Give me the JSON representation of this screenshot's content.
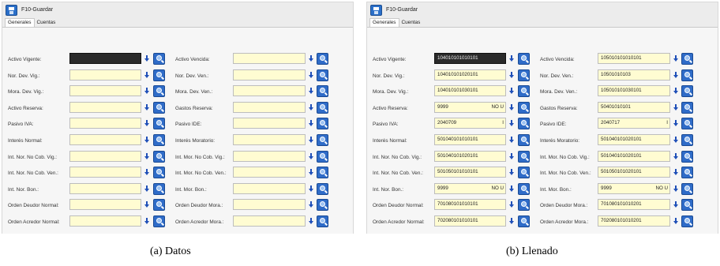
{
  "window_title": "F10-Guardar",
  "tabs": [
    "Generales",
    "Cuentas"
  ],
  "captions": [
    "(a)  Datos",
    "(b)  Llenado"
  ],
  "panels": [
    {
      "rows": [
        {
          "left": {
            "label": "Activo Vigente:",
            "value": "",
            "suffix": ""
          },
          "right": {
            "label": "Activo Vencida:",
            "value": "",
            "suffix": ""
          }
        },
        {
          "left": {
            "label": "Nor. Dev. Vig.:",
            "value": "",
            "suffix": ""
          },
          "right": {
            "label": "Nor. Dev. Ven.:",
            "value": "",
            "suffix": ""
          }
        },
        {
          "left": {
            "label": "Mora. Dev. Vig.:",
            "value": "",
            "suffix": ""
          },
          "right": {
            "label": "Mora. Dev. Ven.:",
            "value": "",
            "suffix": ""
          }
        },
        {
          "left": {
            "label": "Activo Reserva:",
            "value": "",
            "suffix": ""
          },
          "right": {
            "label": "Gastos Reserva:",
            "value": "",
            "suffix": ""
          }
        },
        {
          "left": {
            "label": "Pasivo IVA:",
            "value": "",
            "suffix": ""
          },
          "right": {
            "label": "Pasivo IDE:",
            "value": "",
            "suffix": ""
          }
        },
        {
          "left": {
            "label": "Interés Normal:",
            "value": "",
            "suffix": ""
          },
          "right": {
            "label": "Interés Moratorio:",
            "value": "",
            "suffix": ""
          }
        },
        {
          "left": {
            "label": "Int. Nor. No Cob. Vig.:",
            "value": "",
            "suffix": ""
          },
          "right": {
            "label": "Int. Mor. No Cob. Vig.:",
            "value": "",
            "suffix": ""
          }
        },
        {
          "left": {
            "label": "Int. Nor. No Cob. Ven.:",
            "value": "",
            "suffix": ""
          },
          "right": {
            "label": "Int. Mor. No Cob. Ven.:",
            "value": "",
            "suffix": ""
          }
        },
        {
          "left": {
            "label": "Int. Nor. Bon.:",
            "value": "",
            "suffix": ""
          },
          "right": {
            "label": "Int. Mor. Bon.:",
            "value": "",
            "suffix": ""
          }
        },
        {
          "left": {
            "label": "Orden Deudor Normal:",
            "value": "",
            "suffix": ""
          },
          "right": {
            "label": "Orden Deudor Mora.:",
            "value": "",
            "suffix": ""
          }
        },
        {
          "left": {
            "label": "Orden Acredor Normal:",
            "value": "",
            "suffix": ""
          },
          "right": {
            "label": "Orden Acredor Mora.:",
            "value": "",
            "suffix": ""
          }
        }
      ]
    },
    {
      "rows": [
        {
          "left": {
            "label": "Activo Vigente:",
            "value": "104010101010101",
            "suffix": ""
          },
          "right": {
            "label": "Activo Vencida:",
            "value": "105010101010101",
            "suffix": ""
          }
        },
        {
          "left": {
            "label": "Nor. Dev. Vig.:",
            "value": "104010101020101",
            "suffix": ""
          },
          "right": {
            "label": "Nor. Dev. Ven.:",
            "value": "10501010103",
            "suffix": ""
          }
        },
        {
          "left": {
            "label": "Mora. Dev. Vig.:",
            "value": "104010101030101",
            "suffix": ""
          },
          "right": {
            "label": "Mora. Dev. Ven.:",
            "value": "105010101030101",
            "suffix": ""
          }
        },
        {
          "left": {
            "label": "Activo Reserva:",
            "value": "9999",
            "suffix": "NO U"
          },
          "right": {
            "label": "Gastos Reserva:",
            "value": "50401010101",
            "suffix": ""
          }
        },
        {
          "left": {
            "label": "Pasivo IVA:",
            "value": "2040709",
            "suffix": "I"
          },
          "right": {
            "label": "Pasivo IDE:",
            "value": "2040717",
            "suffix": "I"
          }
        },
        {
          "left": {
            "label": "Interés Normal:",
            "value": "501040101010101",
            "suffix": ""
          },
          "right": {
            "label": "Interés Moratorio:",
            "value": "501040101020101",
            "suffix": ""
          }
        },
        {
          "left": {
            "label": "Int. Nor. No Cob. Vig.:",
            "value": "501040101020101",
            "suffix": ""
          },
          "right": {
            "label": "Int. Mor. No Cob. Vig.:",
            "value": "501040101020101",
            "suffix": ""
          }
        },
        {
          "left": {
            "label": "Int. Nor. No Cob. Ven.:",
            "value": "501050101010101",
            "suffix": ""
          },
          "right": {
            "label": "Int. Mor. No Cob. Ven.:",
            "value": "501050101020101",
            "suffix": ""
          }
        },
        {
          "left": {
            "label": "Int. Nor. Bon.:",
            "value": "9999",
            "suffix": "NO U"
          },
          "right": {
            "label": "Int. Mor. Bon.:",
            "value": "9999",
            "suffix": "NO U"
          }
        },
        {
          "left": {
            "label": "Orden Deudor Normal:",
            "value": "701080101010101",
            "suffix": ""
          },
          "right": {
            "label": "Orden Deudor Mora.:",
            "value": "701080101010201",
            "suffix": ""
          }
        },
        {
          "left": {
            "label": "Orden Acredor Normal:",
            "value": "702080101010101",
            "suffix": ""
          },
          "right": {
            "label": "Orden Acredor Mora.:",
            "value": "702080101010201",
            "suffix": ""
          }
        }
      ]
    }
  ]
}
